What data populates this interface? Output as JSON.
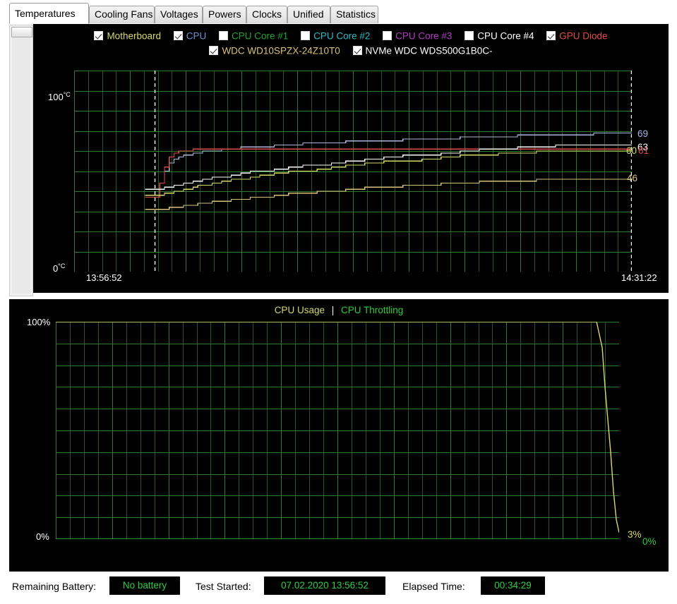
{
  "window": {
    "title": "Temperatures"
  },
  "tabs": [
    {
      "label": "Temperatures",
      "selected": true
    },
    {
      "label": "Cooling Fans",
      "selected": false
    },
    {
      "label": "Voltages",
      "selected": false
    },
    {
      "label": "Powers",
      "selected": false
    },
    {
      "label": "Clocks",
      "selected": false
    },
    {
      "label": "Unified",
      "selected": false
    },
    {
      "label": "Statistics",
      "selected": false
    }
  ],
  "scrollbar": {
    "name": "vertical-scrollbar",
    "thumb_position": "top"
  },
  "temperature_chart": {
    "legend_row1": [
      {
        "label": "Motherboard",
        "checked": true,
        "color": "#d8d86a"
      },
      {
        "label": "CPU",
        "checked": true,
        "color": "#6f8fd8"
      },
      {
        "label": "CPU Core #1",
        "checked": false,
        "color": "#23a23a"
      },
      {
        "label": "CPU Core #2",
        "checked": false,
        "color": "#2fb9c4"
      },
      {
        "label": "CPU Core #3",
        "checked": false,
        "color": "#b23cc4"
      },
      {
        "label": "CPU Core #4",
        "checked": false,
        "color": "#ffffff"
      },
      {
        "label": "GPU Diode",
        "checked": true,
        "color": "#e04b4b"
      }
    ],
    "legend_row2": [
      {
        "label": "WDC WD10SPZX-24Z10T0",
        "checked": true,
        "color": "#d8c27a"
      },
      {
        "label": "NVMe WDC WDS500G1B0C-",
        "checked": true,
        "color": "#ffffff"
      }
    ],
    "y_axis": {
      "top_label": "100",
      "top_unit": "°C",
      "bottom_label": "0",
      "bottom_unit": "°C",
      "min": 0,
      "max": 100
    },
    "x_axis": {
      "start_time": "13:56:52",
      "end_time": "14:31:22"
    },
    "end_values": [
      {
        "value": "69",
        "color": "#aab8e0"
      },
      {
        "value": "63",
        "color": "#ffffff"
      },
      {
        "value": "60",
        "color": "#d8d86a"
      },
      {
        "value": "61",
        "color": "#e04b4b"
      },
      {
        "value": "46",
        "color": "#d8c27a"
      }
    ]
  },
  "usage_chart": {
    "title_usage": "CPU Usage",
    "title_separator": "|",
    "title_throttling": "CPU Throttling",
    "color_usage": "#d8d86a",
    "color_throttling": "#2ecc40",
    "y_axis": {
      "top_label": "100%",
      "bottom_label": "0%",
      "min": 0,
      "max": 100
    },
    "end_values": [
      {
        "value": "3%",
        "color": "#d8d86a"
      },
      {
        "value": "0%",
        "color": "#2ecc40"
      }
    ]
  },
  "status_bar": {
    "battery_label": "Remaining Battery:",
    "battery_value": "No battery",
    "started_label": "Test Started:",
    "started_value": "07.02.2020 13:56:52",
    "elapsed_label": "Elapsed Time:",
    "elapsed_value": "00:34:29"
  },
  "chart_data": [
    {
      "type": "line",
      "title": "Temperatures",
      "xlabel": "",
      "ylabel": "°C",
      "ylim": [
        0,
        100
      ],
      "xlim": [
        "13:56:52",
        "14:31:22"
      ],
      "grid": true,
      "legend_position": "top",
      "x": [
        0,
        1,
        2,
        3,
        4,
        5,
        6,
        7,
        8,
        9,
        10,
        12,
        14,
        16,
        18,
        20,
        22,
        25,
        28,
        31,
        34,
        37,
        40,
        44,
        48,
        52,
        56,
        60,
        64,
        68,
        72,
        76,
        80,
        84,
        88,
        92,
        96,
        100
      ],
      "series": [
        {
          "name": "CPU",
          "color": "#aab8e0",
          "final_value": 69,
          "values": [
            41,
            44,
            50,
            54,
            56,
            57,
            58,
            58,
            59,
            59,
            60,
            60,
            61,
            61,
            62,
            62,
            62,
            63,
            63,
            64,
            64,
            64,
            65,
            65,
            65,
            66,
            66,
            66,
            67,
            67,
            67,
            68,
            68,
            68,
            68,
            69,
            69,
            69
          ]
        },
        {
          "name": "GPU Diode",
          "color": "#e04b4b",
          "final_value": 61,
          "values": [
            37,
            44,
            52,
            57,
            59,
            60,
            60,
            60,
            61,
            61,
            61,
            61,
            61,
            61,
            61,
            61,
            61,
            61,
            61,
            61,
            61,
            61,
            61,
            61,
            61,
            61,
            61,
            61,
            61,
            61,
            61,
            61,
            61,
            61,
            61,
            61,
            61,
            61
          ]
        },
        {
          "name": "NVMe WDC WDS500G1B0C-",
          "color": "#ffffff",
          "final_value": 63,
          "values": [
            41,
            41,
            42,
            42,
            43,
            43,
            44,
            44,
            45,
            45,
            46,
            47,
            47,
            48,
            49,
            50,
            50,
            51,
            52,
            53,
            53,
            54,
            55,
            56,
            57,
            58,
            58,
            59,
            60,
            61,
            61,
            62,
            62,
            63,
            63,
            63,
            63,
            63
          ]
        },
        {
          "name": "Motherboard",
          "color": "#d8d86a",
          "final_value": 60,
          "values": [
            38,
            38,
            39,
            39,
            40,
            40,
            41,
            41,
            42,
            43,
            43,
            44,
            45,
            46,
            46,
            47,
            48,
            49,
            50,
            50,
            51,
            52,
            53,
            54,
            55,
            55,
            56,
            57,
            58,
            58,
            59,
            59,
            60,
            60,
            60,
            60,
            60,
            60
          ]
        },
        {
          "name": "WDC WD10SPZX-24Z10T0",
          "color": "#d8c27a",
          "final_value": 46,
          "values": [
            31,
            31,
            31,
            32,
            32,
            32,
            33,
            33,
            33,
            34,
            34,
            35,
            35,
            36,
            36,
            37,
            37,
            38,
            39,
            39,
            40,
            40,
            41,
            42,
            42,
            43,
            43,
            44,
            44,
            45,
            45,
            45,
            46,
            46,
            46,
            46,
            46,
            46
          ]
        }
      ]
    },
    {
      "type": "line",
      "title": "CPU Usage | CPU Throttling",
      "xlabel": "",
      "ylabel": "%",
      "ylim": [
        0,
        100
      ],
      "grid": true,
      "legend_position": "top",
      "x": [
        0,
        10,
        20,
        30,
        40,
        50,
        60,
        70,
        80,
        90,
        95,
        96,
        97,
        97.5,
        98,
        98.5,
        99,
        99.5,
        100
      ],
      "series": [
        {
          "name": "CPU Usage",
          "color": "#d8d86a",
          "final_value": 3,
          "values": [
            100,
            100,
            100,
            100,
            100,
            100,
            100,
            100,
            100,
            100,
            100,
            100,
            88,
            70,
            55,
            40,
            22,
            9,
            3
          ]
        },
        {
          "name": "CPU Throttling",
          "color": "#2ecc40",
          "final_value": 0,
          "values": [
            0,
            0,
            0,
            0,
            0,
            0,
            0,
            0,
            0,
            0,
            0,
            0,
            0,
            0,
            0,
            0,
            0,
            0,
            0
          ]
        }
      ]
    }
  ]
}
